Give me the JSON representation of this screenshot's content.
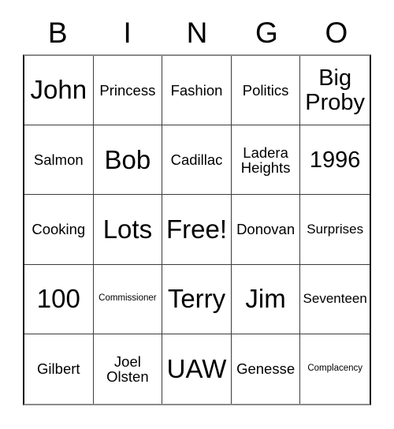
{
  "card": {
    "title": "BINGO",
    "header_letters": [
      "B",
      "I",
      "N",
      "G",
      "O"
    ],
    "free_space_label": "Free!",
    "colors": {
      "background": "#ffffff",
      "text": "#000000",
      "grid_line": "#3c3c3c",
      "outer_border": "#111111"
    },
    "cells": [
      {
        "text": "John",
        "size": "xl"
      },
      {
        "text": "Princess",
        "size": "md"
      },
      {
        "text": "Fashion",
        "size": "md"
      },
      {
        "text": "Politics",
        "size": "md"
      },
      {
        "text": "Big\nProby",
        "size": "lg"
      },
      {
        "text": "Salmon",
        "size": "md"
      },
      {
        "text": "Bob",
        "size": "xl"
      },
      {
        "text": "Cadillac",
        "size": "md"
      },
      {
        "text": "Ladera\nHeights",
        "size": "md"
      },
      {
        "text": "1996",
        "size": "lg"
      },
      {
        "text": "Cooking",
        "size": "md"
      },
      {
        "text": "Lots",
        "size": "xl"
      },
      {
        "text": "Free!",
        "size": "xl"
      },
      {
        "text": "Donovan",
        "size": "md"
      },
      {
        "text": "Surprises",
        "size": "sm"
      },
      {
        "text": "100",
        "size": "xl"
      },
      {
        "text": "Commissioner",
        "size": "xs"
      },
      {
        "text": "Terry",
        "size": "xl"
      },
      {
        "text": "Jim",
        "size": "xl"
      },
      {
        "text": "Seventeen",
        "size": "sm"
      },
      {
        "text": "Gilbert",
        "size": "md"
      },
      {
        "text": "Joel\nOlsten",
        "size": "md"
      },
      {
        "text": "UAW",
        "size": "xl"
      },
      {
        "text": "Genesse",
        "size": "md"
      },
      {
        "text": "Complacency",
        "size": "xs"
      }
    ]
  }
}
